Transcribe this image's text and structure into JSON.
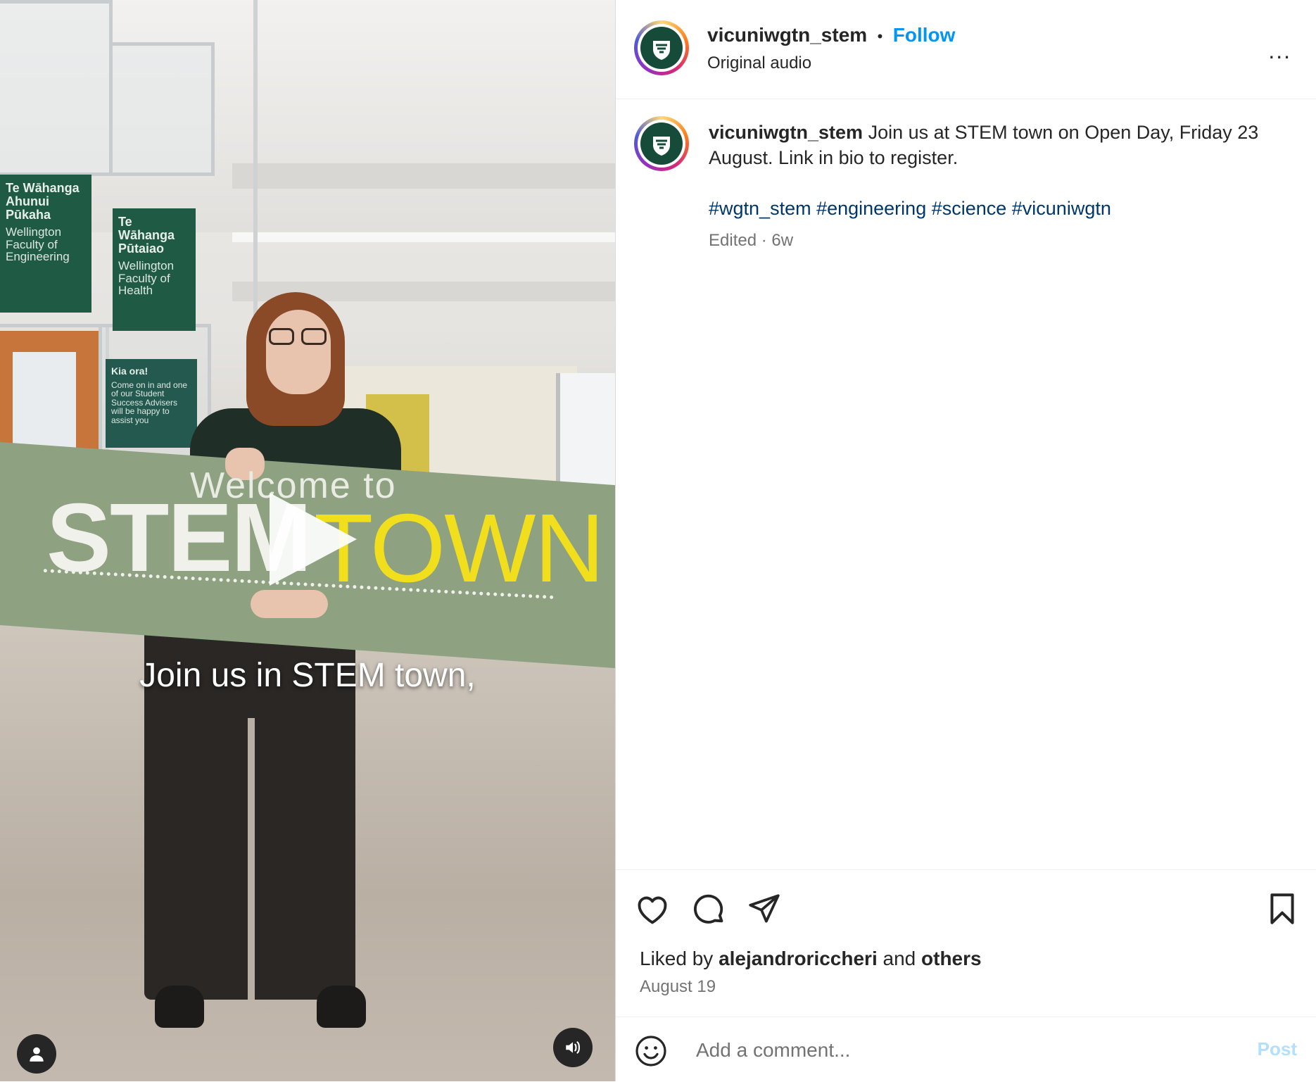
{
  "video": {
    "signs": [
      {
        "title": "Te Wāhanga Ahunui Pūkaha",
        "sub": "Wellington Faculty of Engineering"
      },
      {
        "title": "Te Wāhanga Pūtaiao",
        "sub": "Wellington Faculty of Health"
      }
    ],
    "notice": {
      "title": "Kia ora!",
      "body": "Come on in and one of our Student Success Advisers will be happy to assist you"
    },
    "banner_welcome": "Welcome to",
    "banner_stem": "STEM",
    "banner_town": "TOWN",
    "caption": "Join us in STEM town,",
    "icons": {
      "play": "play-icon",
      "user": "user-tag-icon",
      "sound": "speaker-icon"
    }
  },
  "header": {
    "username": "vicuniwgtn_stem",
    "separator": "•",
    "follow_label": "Follow",
    "audio": "Original audio",
    "more": "..."
  },
  "post": {
    "username": "vicuniwgtn_stem",
    "text": "Join us at STEM town on Open Day, Friday 23 August. Link in bio to register.",
    "hashtags": "#wgtn_stem #engineering #science #vicuniwgtn",
    "meta": "Edited · 6w"
  },
  "actions": {
    "liked_prefix": "Liked by",
    "liked_user": "alejandroriccheri",
    "liked_and": "and",
    "liked_others": "others",
    "date": "August 19"
  },
  "comment": {
    "placeholder": "Add a comment...",
    "post_label": "Post"
  },
  "colors": {
    "follow": "#0095f6",
    "hashtag": "#00376b",
    "post_disabled": "#b2dffc",
    "brand_green": "#174b39"
  }
}
